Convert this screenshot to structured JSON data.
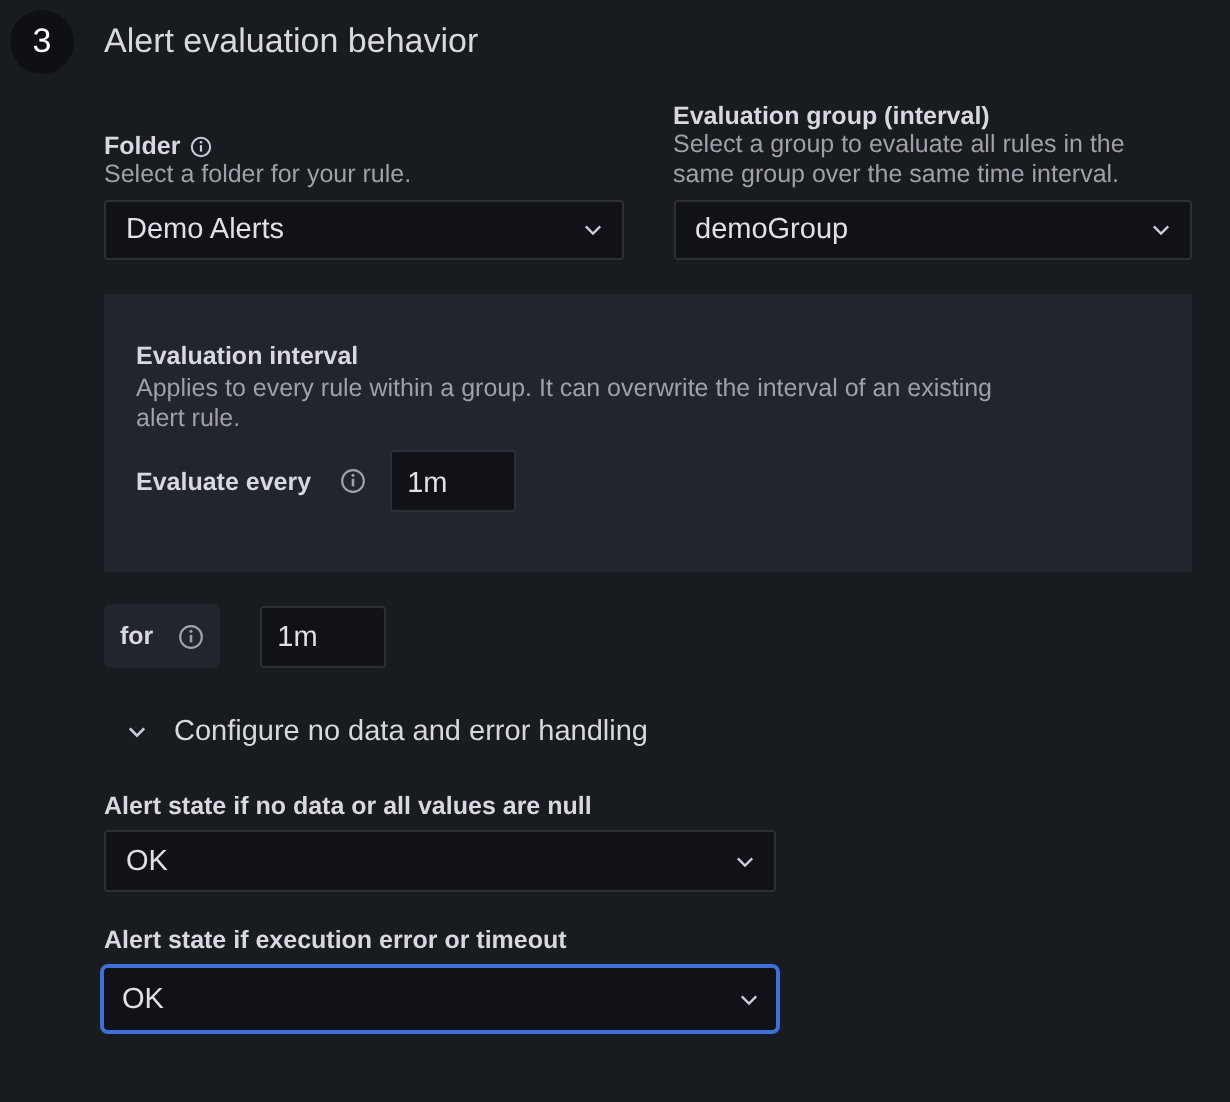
{
  "step": {
    "number": "3",
    "title": "Alert evaluation behavior"
  },
  "folder": {
    "label": "Folder",
    "description": "Select a folder for your rule.",
    "value": "Demo Alerts"
  },
  "group": {
    "label": "Evaluation group (interval)",
    "description": "Select a group to evaluate all rules in the same group over the same time interval.",
    "value": "demoGroup"
  },
  "interval": {
    "title": "Evaluation interval",
    "description": "Applies to every rule within a group. It can overwrite the interval of an existing alert rule.",
    "label": "Evaluate every",
    "value": "1m"
  },
  "pending": {
    "label": "for",
    "value": "1m"
  },
  "error_handling": {
    "title": "Configure no data and error handling",
    "expanded": true,
    "fields": [
      {
        "label": "Alert state if no data or all values are null",
        "value": "OK",
        "focused": false
      },
      {
        "label": "Alert state if execution error or timeout",
        "value": "OK",
        "focused": true
      }
    ]
  }
}
